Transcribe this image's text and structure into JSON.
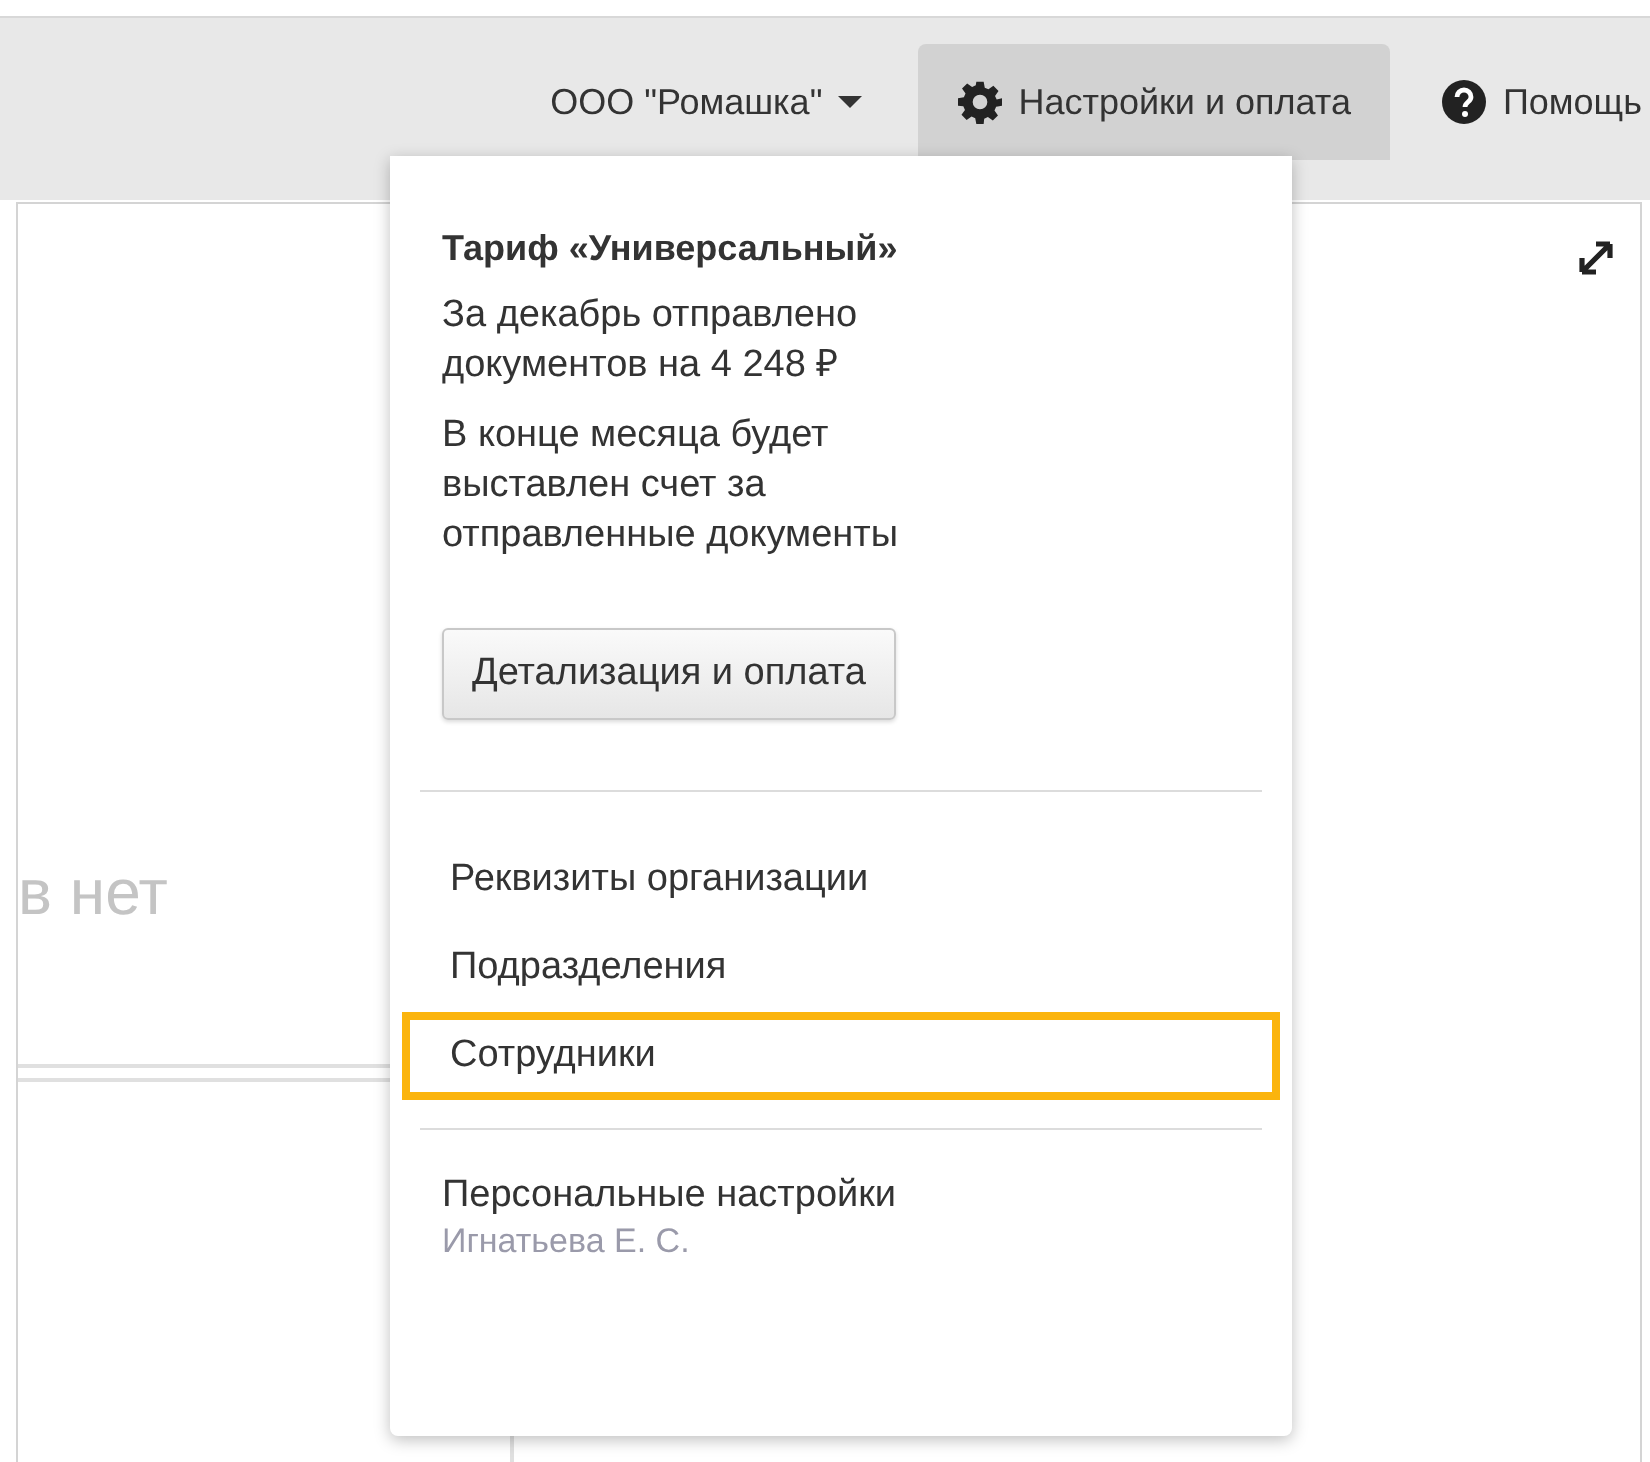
{
  "top_nav": [
    {
      "label": "ООО \"Ромашка\"",
      "kind": "dropdown",
      "selected": false
    },
    {
      "label": "Настройки и оплата",
      "kind": "settings",
      "selected": true
    },
    {
      "label": "Помощь",
      "kind": "help",
      "selected": false
    }
  ],
  "background": {
    "empty_text": "в нет"
  },
  "settings_menu": {
    "tariff_title": "Тариф «Универсальный»",
    "sent_text": "За декабрь отправлено документов на 4 248 ₽",
    "invoice_text": "В конце месяца будет выставлен счет за отправленные документы",
    "details_button": "Детализация и оплата",
    "items": [
      {
        "label": "Реквизиты организации",
        "selected": false
      },
      {
        "label": "Подразделения",
        "selected": false
      },
      {
        "label": "Сотрудники",
        "selected": true
      }
    ],
    "personal": {
      "label": "Персональные настройки",
      "user": "Игнатьева Е. С."
    }
  }
}
